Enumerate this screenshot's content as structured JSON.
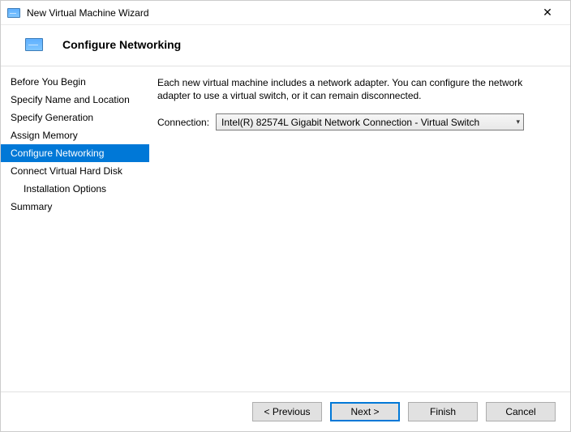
{
  "window": {
    "title": "New Virtual Machine Wizard"
  },
  "header": {
    "title": "Configure Networking"
  },
  "sidebar": {
    "steps": [
      {
        "label": "Before You Begin",
        "selected": false,
        "sub": false
      },
      {
        "label": "Specify Name and Location",
        "selected": false,
        "sub": false
      },
      {
        "label": "Specify Generation",
        "selected": false,
        "sub": false
      },
      {
        "label": "Assign Memory",
        "selected": false,
        "sub": false
      },
      {
        "label": "Configure Networking",
        "selected": true,
        "sub": false
      },
      {
        "label": "Connect Virtual Hard Disk",
        "selected": false,
        "sub": false
      },
      {
        "label": "Installation Options",
        "selected": false,
        "sub": true
      },
      {
        "label": "Summary",
        "selected": false,
        "sub": false
      }
    ]
  },
  "content": {
    "description": "Each new virtual machine includes a network adapter. You can configure the network adapter to use a virtual switch, or it can remain disconnected.",
    "connection_label": "Connection:",
    "connection_value": "Intel(R) 82574L Gigabit Network Connection - Virtual Switch"
  },
  "buttons": {
    "previous": "< Previous",
    "next": "Next >",
    "finish": "Finish",
    "cancel": "Cancel"
  }
}
